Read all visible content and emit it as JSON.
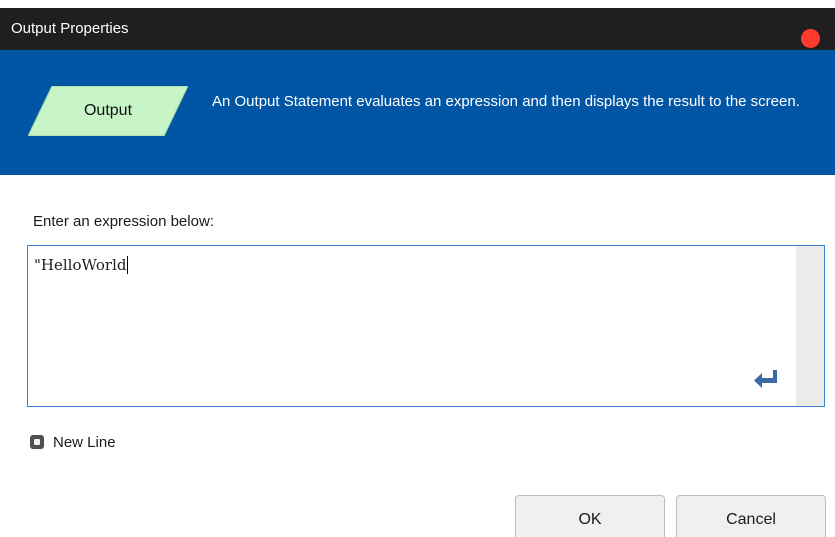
{
  "window": {
    "title": "Output Properties",
    "close_color": "#ff3b30"
  },
  "header": {
    "shape_label": "Output",
    "shape_color": "#c8f5c8",
    "background_color": "#0055a5",
    "description": "An Output Statement evaluates an expression and then displays the result to the screen."
  },
  "body": {
    "prompt": "Enter an expression below:",
    "expression_value": "\"HelloWorld",
    "enter_icon": "return-arrow-icon",
    "new_line_label": "New Line",
    "new_line_checked": false
  },
  "buttons": {
    "ok_label": "OK",
    "cancel_label": "Cancel"
  }
}
